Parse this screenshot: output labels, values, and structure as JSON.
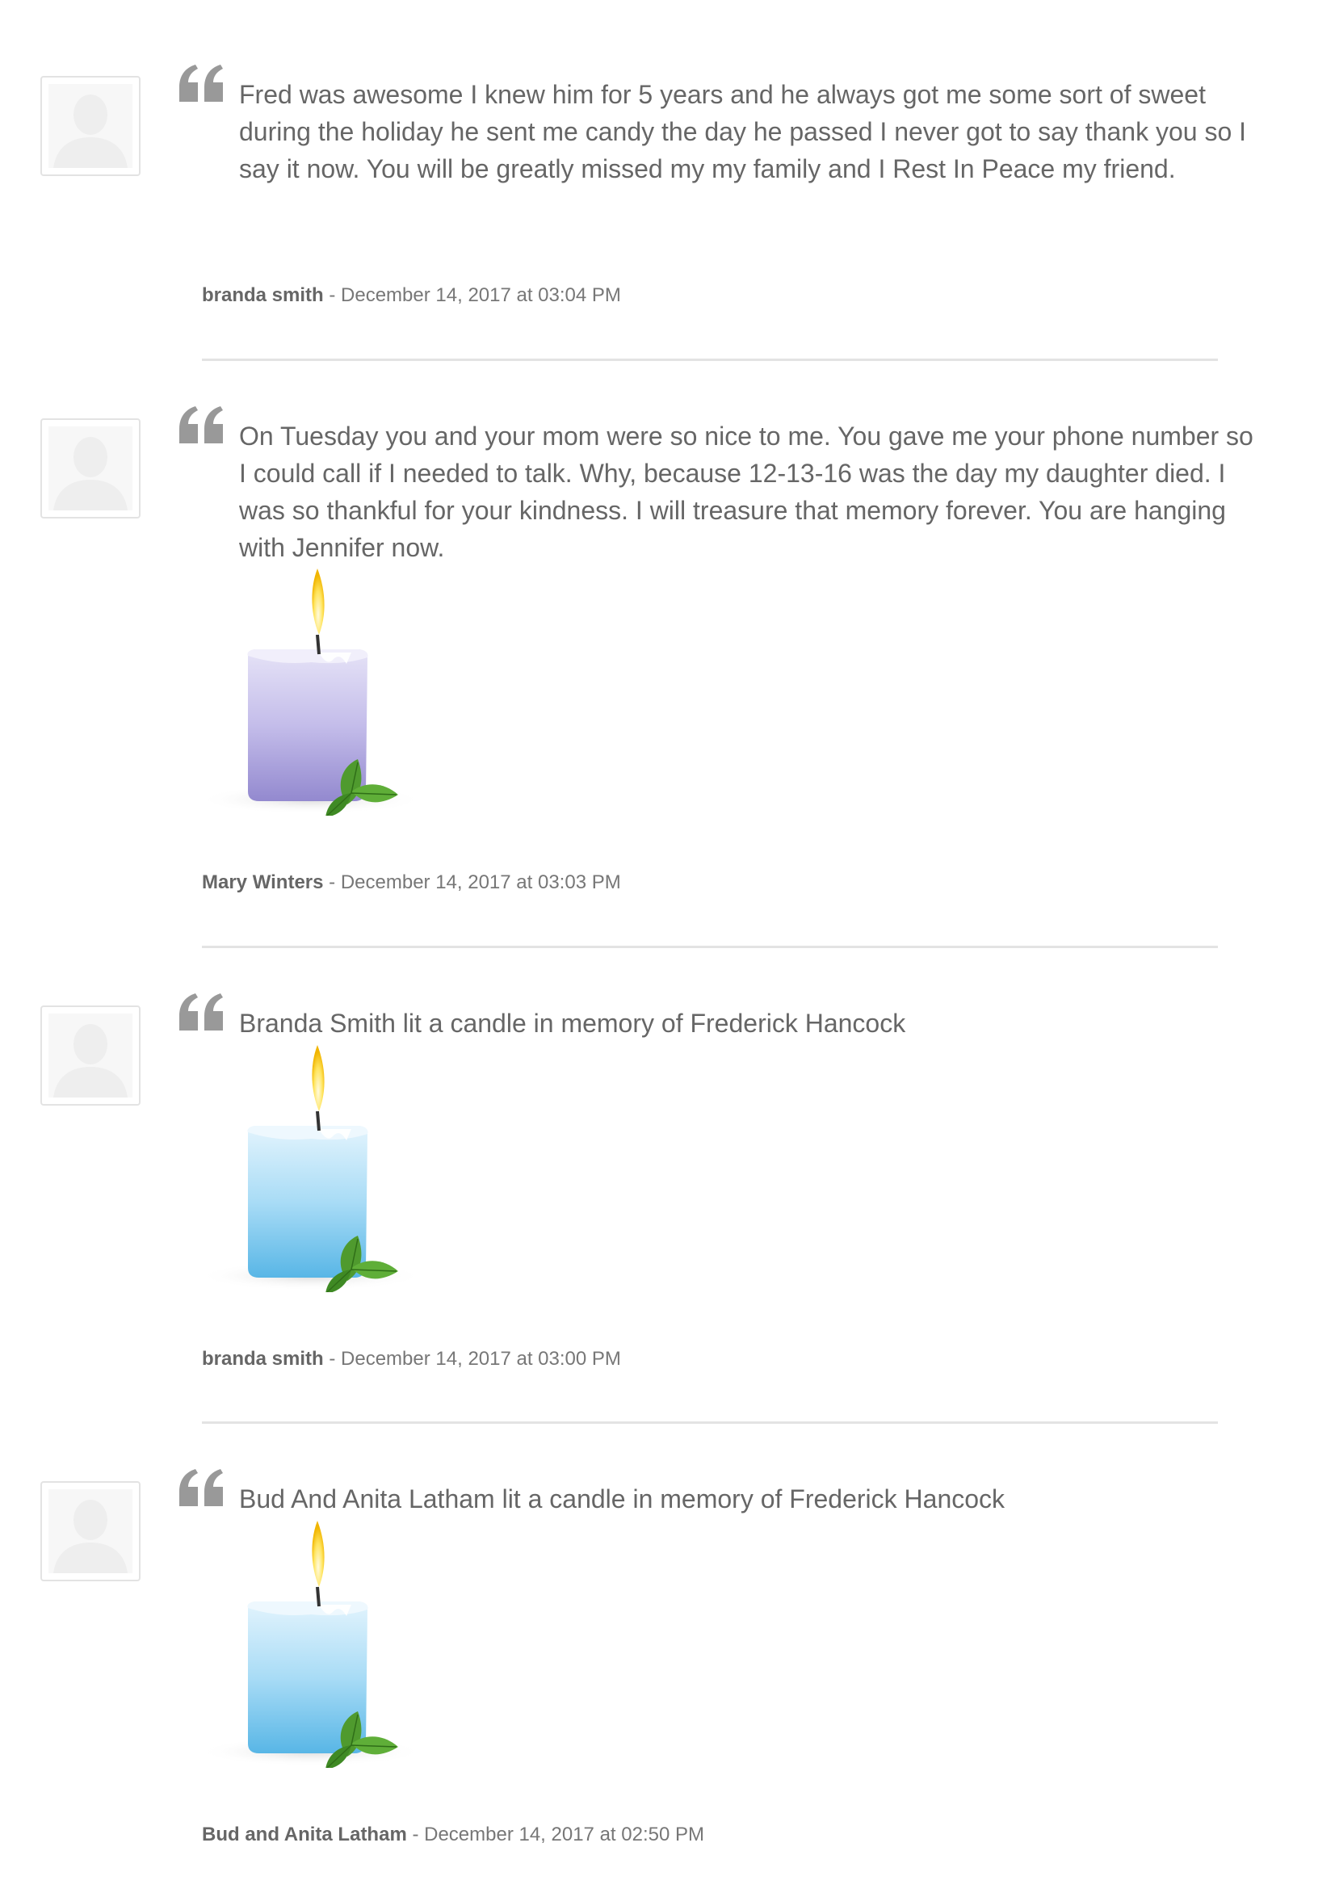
{
  "tributes": [
    {
      "message": "Fred was awesome I knew him for 5 years and he always got me some sort of sweet during the holiday he sent me candy the day he passed I never got to say thank you so I say it now. You will be greatly missed my my family and I Rest In Peace my friend.",
      "author": "branda smith",
      "separator": " - ",
      "date": "December 14, 2017 at 03:04 PM",
      "candle": null
    },
    {
      "message": "On Tuesday you and your mom were so nice to me. You gave me your phone number so I could call if I needed to talk. Why, because 12-13-16 was the day my daughter died. I was so thankful for your kindness. I will treasure that memory forever. You are hanging with Jennifer now.",
      "author": "Mary Winters",
      "separator": " - ",
      "date": "December 14, 2017 at 03:03 PM",
      "candle": "lavender"
    },
    {
      "message": "Branda Smith lit a candle in memory of Frederick Hancock",
      "author": "branda smith",
      "separator": " - ",
      "date": "December 14, 2017 at 03:00 PM",
      "candle": "blue"
    },
    {
      "message": "Bud And Anita Latham lit a candle in memory of Frederick Hancock",
      "author": "Bud and Anita Latham",
      "separator": " - ",
      "date": "December 14, 2017 at 02:50 PM",
      "candle": "blue"
    }
  ],
  "icons": {
    "avatar": "default-avatar-icon",
    "quote": "quote-mark-icon",
    "candle": "candle-icon"
  },
  "colors": {
    "text": "#666666",
    "byline": "#777777",
    "divider": "#e3e3e3",
    "quote": "#999999",
    "candle_lavender": "#a99fd8",
    "candle_blue": "#6fc3ee",
    "leaf": "#4f9a2e"
  }
}
